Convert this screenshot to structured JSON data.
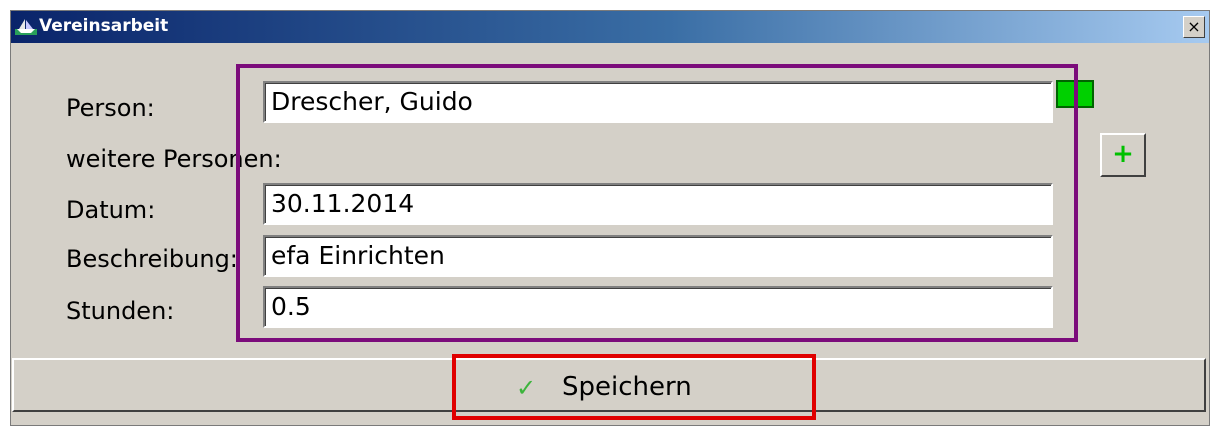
{
  "window": {
    "title": "Vereinsarbeit",
    "close_label": "×"
  },
  "form": {
    "person_label": "Person:",
    "person_value": "Drescher, Guido",
    "weitere_label": "weitere Personen:",
    "datum_label": "Datum:",
    "datum_value": "30.11.2014",
    "beschreibung_label": "Beschreibung:",
    "beschreibung_value": "efa Einrichten",
    "stunden_label": "Stunden:",
    "stunden_value": "0.5"
  },
  "buttons": {
    "add_label": "+",
    "save_icon": "✓",
    "save_label": "Speichern"
  },
  "icons": {
    "title_icon": "boat-icon",
    "status_icon": "status-indicator-icon",
    "save_icon": "check-icon"
  },
  "colors": {
    "title_start": "#0a246a",
    "title_end": "#a6caf0",
    "highlight_purple": "#7b0b7b",
    "highlight_red": "#e00000",
    "status_green": "#00d000",
    "add_plus_green": "#00c000",
    "check_green": "#3cb43c"
  }
}
